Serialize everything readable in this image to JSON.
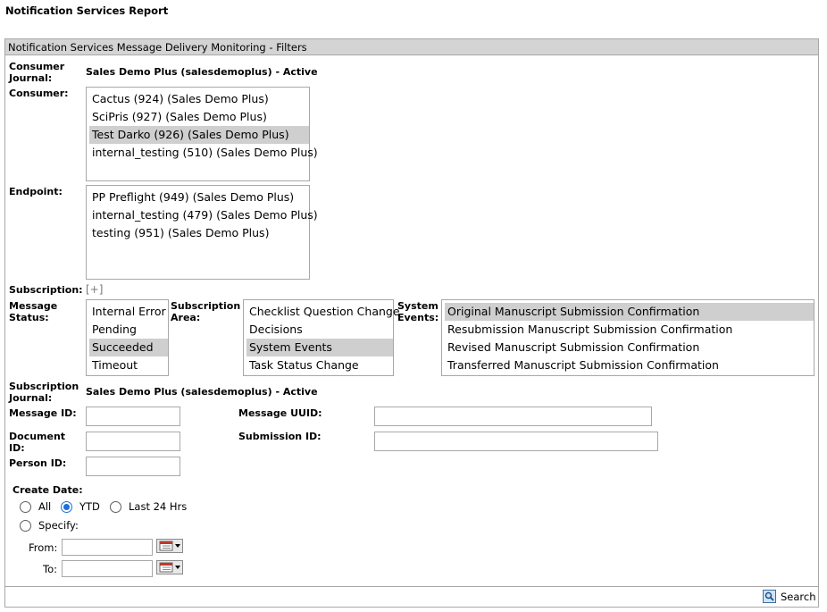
{
  "page": {
    "title": "Notification Services Report"
  },
  "panel": {
    "title": "Notification Services Message Delivery Monitoring - Filters"
  },
  "consumer_journal": {
    "label": "Consumer Journal:",
    "value": "Sales Demo Plus (salesdemoplus) - Active"
  },
  "consumer": {
    "label": "Consumer:",
    "options": [
      {
        "text": "Cactus (924) (Sales Demo Plus)",
        "selected": false
      },
      {
        "text": "SciPris (927) (Sales Demo Plus)",
        "selected": false
      },
      {
        "text": "Test Darko (926) (Sales Demo Plus)",
        "selected": true
      },
      {
        "text": "internal_testing (510) (Sales Demo Plus)",
        "selected": false
      }
    ]
  },
  "endpoint": {
    "label": "Endpoint:",
    "options": [
      {
        "text": "PP Preflight (949) (Sales Demo Plus)",
        "selected": false
      },
      {
        "text": "internal_testing (479) (Sales Demo Plus)",
        "selected": false
      },
      {
        "text": "testing (951) (Sales Demo Plus)",
        "selected": false
      }
    ]
  },
  "subscription": {
    "label": "Subscription:",
    "expand": "[+]"
  },
  "message_status": {
    "label": "Message Status:",
    "options": [
      {
        "text": "Internal Error",
        "selected": false
      },
      {
        "text": "Pending",
        "selected": false
      },
      {
        "text": "Succeeded",
        "selected": true
      },
      {
        "text": "Timeout",
        "selected": false
      }
    ]
  },
  "subscription_area": {
    "label": "Subscription Area:",
    "options": [
      {
        "text": "Checklist Question Change",
        "selected": false
      },
      {
        "text": "Decisions",
        "selected": false
      },
      {
        "text": "System Events",
        "selected": true
      },
      {
        "text": "Task Status Change",
        "selected": false
      }
    ]
  },
  "system_events": {
    "label": "System Events:",
    "options": [
      {
        "text": "Original Manuscript Submission Confirmation",
        "selected": true
      },
      {
        "text": "Resubmission Manuscript Submission Confirmation",
        "selected": false
      },
      {
        "text": "Revised Manuscript Submission Confirmation",
        "selected": false
      },
      {
        "text": "Transferred Manuscript Submission Confirmation",
        "selected": false
      }
    ]
  },
  "subscription_journal": {
    "label": "Subscription Journal:",
    "value": "Sales Demo Plus (salesdemoplus) - Active"
  },
  "fields": {
    "message_id": {
      "label": "Message ID:",
      "value": ""
    },
    "message_uuid": {
      "label": "Message UUID:",
      "value": ""
    },
    "document_id": {
      "label": "Document ID:",
      "value": ""
    },
    "submission_id": {
      "label": "Submission ID:",
      "value": ""
    },
    "person_id": {
      "label": "Person ID:",
      "value": ""
    }
  },
  "create_date": {
    "label": "Create Date:",
    "options": {
      "all": "All",
      "ytd": "YTD",
      "last24": "Last 24 Hrs",
      "specify": "Specify:"
    },
    "selected": "ytd",
    "from_label": "From:",
    "to_label": "To:",
    "from_value": "",
    "to_value": ""
  },
  "footer": {
    "search_label": "Search"
  },
  "icons": {
    "calendar": "calendar-icon",
    "search": "search-icon"
  }
}
